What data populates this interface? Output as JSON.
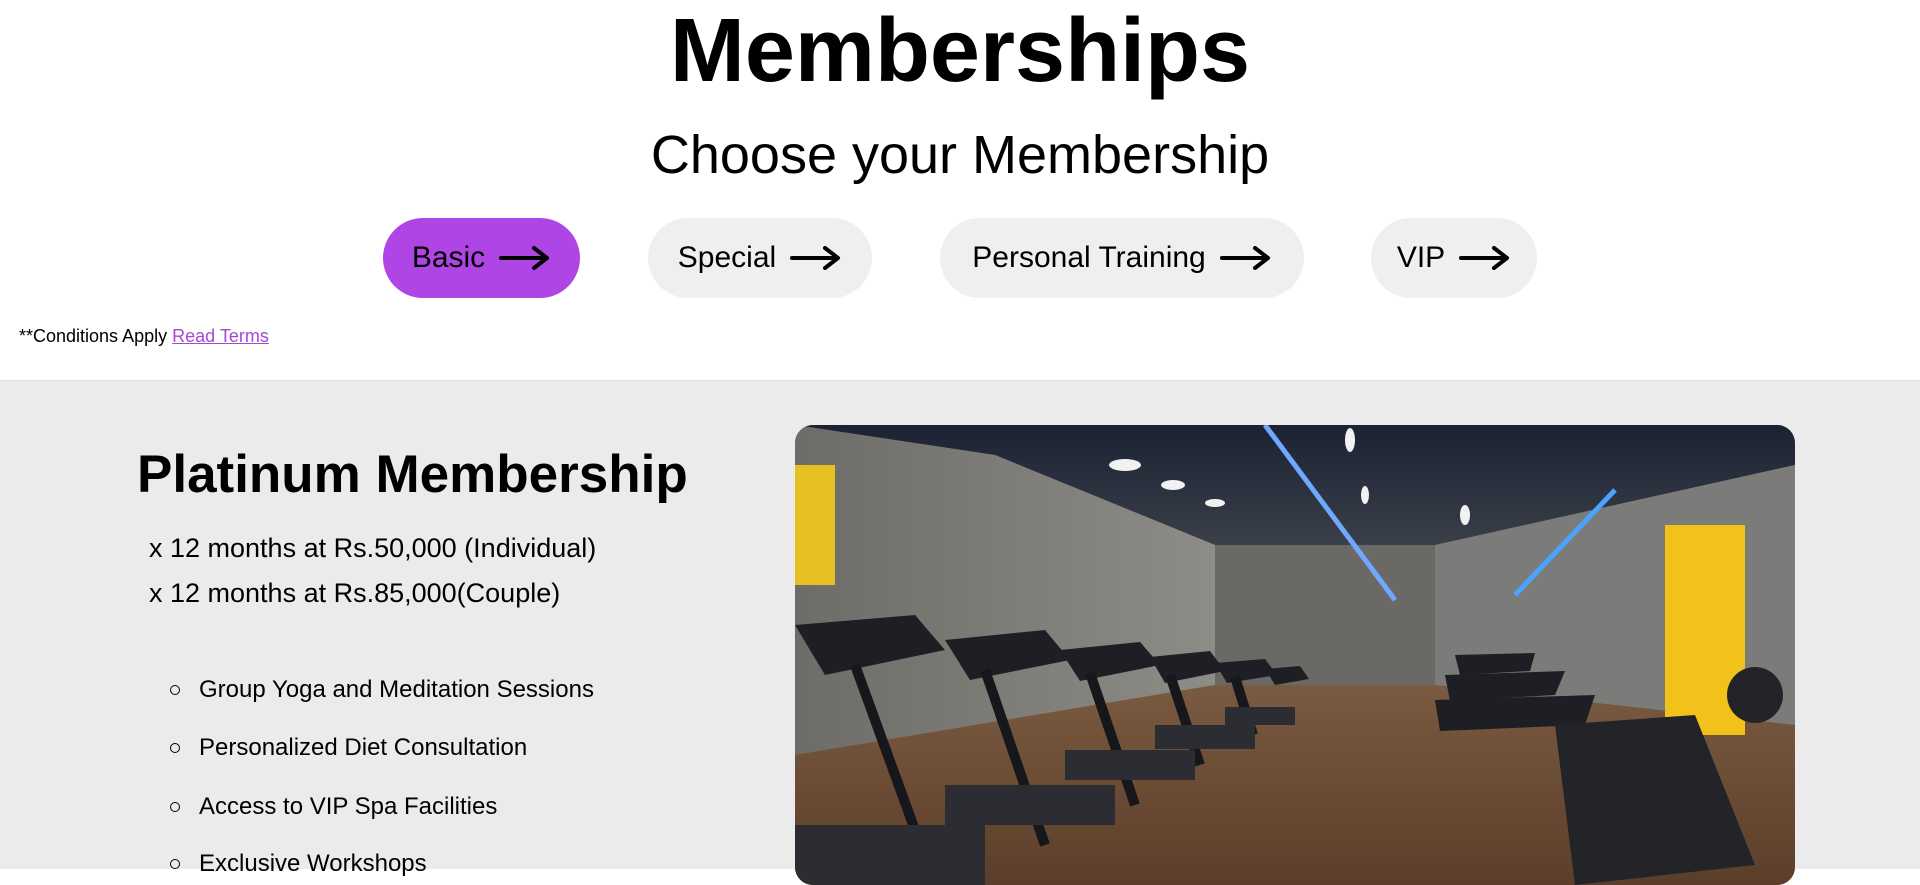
{
  "header": {
    "title": "Memberships",
    "subtitle": "Choose your Membership"
  },
  "tabs": [
    {
      "label": "Basic",
      "active": true
    },
    {
      "label": "Special",
      "active": false
    },
    {
      "label": "Personal Training",
      "active": false
    },
    {
      "label": "VIP",
      "active": false
    }
  ],
  "conditions": {
    "text": "**Conditions Apply",
    "link": "Read Terms"
  },
  "plan": {
    "title": "Platinum Membership",
    "prices": [
      "x 12 months at Rs.50,000 (Individual)",
      "x 12 months at Rs.85,000(Couple)"
    ],
    "features": [
      "Group Yoga and Meditation Sessions",
      "Personalized Diet Consultation",
      "Access to VIP Spa Facilities",
      "Exclusive Workshops"
    ]
  },
  "colors": {
    "accent": "#b045e6",
    "link": "#a349d6",
    "pill_bg": "#efefef",
    "section_bg": "#ebebeb"
  },
  "icons": {
    "tab_arrow": "arrow-right-icon",
    "bullet": "circle-bullet-icon"
  }
}
